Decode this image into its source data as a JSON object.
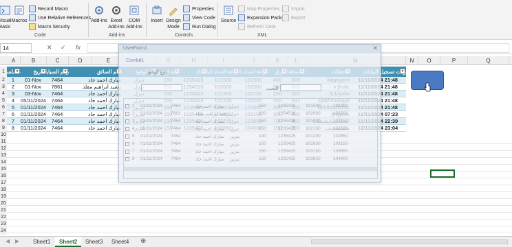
{
  "ribbon": {
    "buttons": {
      "visual_basic": "Visual Basic",
      "macros": "Macros",
      "add_ins": "Add-ins",
      "excel_add_ins": "Excel Add-ins",
      "com_add_ins": "COM Add-ins",
      "insert": "Insert",
      "design_mode": "Design Mode",
      "source": "Source"
    },
    "small": {
      "record_macro": "Record Macro",
      "relative_refs": "Use Relative References",
      "macro_security": "Macro Security",
      "properties": "Properties",
      "view_code": "View Code",
      "run_dialog": "Run Dialog",
      "map_properties": "Map Properties",
      "expansion_packs": "Expansion Packs",
      "refresh_data": "Refresh Data",
      "import": "Import",
      "export": "Export"
    },
    "groups": {
      "code": "Code",
      "add_ins": "Add-ins",
      "controls": "Controls",
      "xml": "XML"
    },
    "colors": {
      "accent": "#1a6b2c",
      "table_header": "#3f8fb3"
    }
  },
  "formula_bar": {
    "name_box": "14",
    "fx": "fx"
  },
  "columns": [
    "A",
    "B",
    "C",
    "D",
    "E",
    "F",
    "G",
    "H",
    "I",
    "J",
    "K",
    "L",
    "M",
    "N",
    "O",
    "P",
    "Q"
  ],
  "rows": [
    "1",
    "2",
    "3",
    "4",
    "5",
    "6",
    "7",
    "8",
    "9",
    "10",
    "11",
    "12",
    "13",
    "14",
    "15",
    "16",
    "17",
    "18",
    "19",
    "20",
    "21",
    "22",
    "23",
    "24",
    "25"
  ],
  "table": {
    "headers": [
      "مسلسل",
      "التاريخ",
      "رقم السيارة",
      "اسم السائق",
      "نوع الوقود",
      "كمية الوقود",
      "العداد",
      "قراءة العداد السابقة",
      "قراءة العداد الحالية",
      "الفرق",
      "المسافة",
      "ملاحظات",
      "وقت تسجيل البيانات"
    ],
    "rows": [
      [
        "1",
        "01-Nov",
        "7464",
        "مبارك احمد جاد",
        "ديزل",
        "150",
        "1235425",
        "101500",
        "101900",
        "400",
        "800",
        "lljkgkjgchf",
        "11/11/2024 21:48"
      ],
      [
        "2",
        "01-Nov",
        "7861",
        "رشيد ابراهيم مقلد",
        "ديزل",
        "200",
        "1254510",
        "102000",
        "102500",
        "500",
        "865",
        "v jhchc",
        "11/11/2024 21:48"
      ],
      [
        "3",
        "03-Nov",
        "7464",
        "مبارك احمد جاد",
        "ديزل",
        "150",
        "1235425",
        "101900",
        "102150",
        "250",
        "522",
        "jk;fuyxhv",
        "11/11/2024 21:48"
      ],
      [
        "4",
        "05/11/2024",
        "7464",
        "مبارك احمد جاد",
        "ديزل",
        "150",
        "1235425",
        "102150",
        "102500",
        "350",
        "641",
        "kjhkfhfuxfuyxf",
        "11/11/2024 21:48"
      ],
      [
        "5",
        "01/11/2024",
        "7464",
        "مبارك احمد جاد",
        "بنزين",
        "190",
        "1235425",
        "101200",
        "102850",
        "300",
        "550",
        "kjhkfhfxzfxchc",
        "11/11/2024 21:48"
      ],
      [
        "6",
        "01/11/2024",
        "7464",
        "مبارك احمد جاد",
        "بنزين",
        "150",
        "1235425",
        "102850",
        "103150",
        "300",
        "380",
        "jhvgcxv,",
        "12/11/2024 07:23"
      ],
      [
        "7",
        "01/11/2024",
        "7464",
        "مبارك احمد جاد",
        "بنزين",
        "150",
        "1235425",
        "103150",
        "103850",
        "700",
        "850",
        "كمنشسيابيتنتىتلب",
        "12/11/2024 22:39"
      ],
      [
        "8",
        "01/11/2024",
        "7464",
        "مبارك احمد جاد",
        "بنزين",
        "150",
        "1235425",
        "103850",
        "104000",
        "150",
        "350",
        "منتبيبيببتبتب",
        "12/11/2024 23:04"
      ]
    ]
  },
  "dialog": {
    "title": "UserForm1",
    "header_label": "Combo1",
    "search_label": "البحث",
    "fuel_label": "نوع الوقود",
    "list_rows": [
      [
        "1",
        "01/11/2024",
        "7464",
        "مبارك احمد جاد",
        "ديزل",
        "150",
        "1235425",
        "101500",
        "101900"
      ],
      [
        "2",
        "01/11/2024",
        "7861",
        "رشيد ابراهيم مقلد",
        "ديزل",
        "200",
        "1254510",
        "102000",
        "102500"
      ],
      [
        "3",
        "03/11/2024",
        "7464",
        "مبارك احمد جاد",
        "ديزل",
        "150",
        "1235425",
        "101900",
        "102150"
      ],
      [
        "4",
        "05/11/2024",
        "7464",
        "مبارك احمد جاد",
        "ديزل",
        "150",
        "1235425",
        "102150",
        "102500"
      ],
      [
        "5",
        "01/11/2024",
        "7464",
        "مبارك احمد جاد",
        "بنزين",
        "190",
        "1235425",
        "101200",
        "102850"
      ],
      [
        "6",
        "01/11/2024",
        "7464",
        "مبارك احمد جاد",
        "بنزين",
        "150",
        "1235425",
        "102850",
        "103150"
      ],
      [
        "7",
        "01/11/2024",
        "7464",
        "مبارك احمد جاد",
        "بنزين",
        "150",
        "1235425",
        "103150",
        "103850"
      ],
      [
        "8",
        "01/11/2024",
        "7464",
        "مبارك احمد جاد",
        "بنزين",
        "150",
        "1235425",
        "103850",
        "104000"
      ]
    ]
  },
  "sheets": [
    "Sheet1",
    "Sheet2",
    "Sheet3",
    "Sheet4"
  ],
  "active_sheet": "Sheet2"
}
